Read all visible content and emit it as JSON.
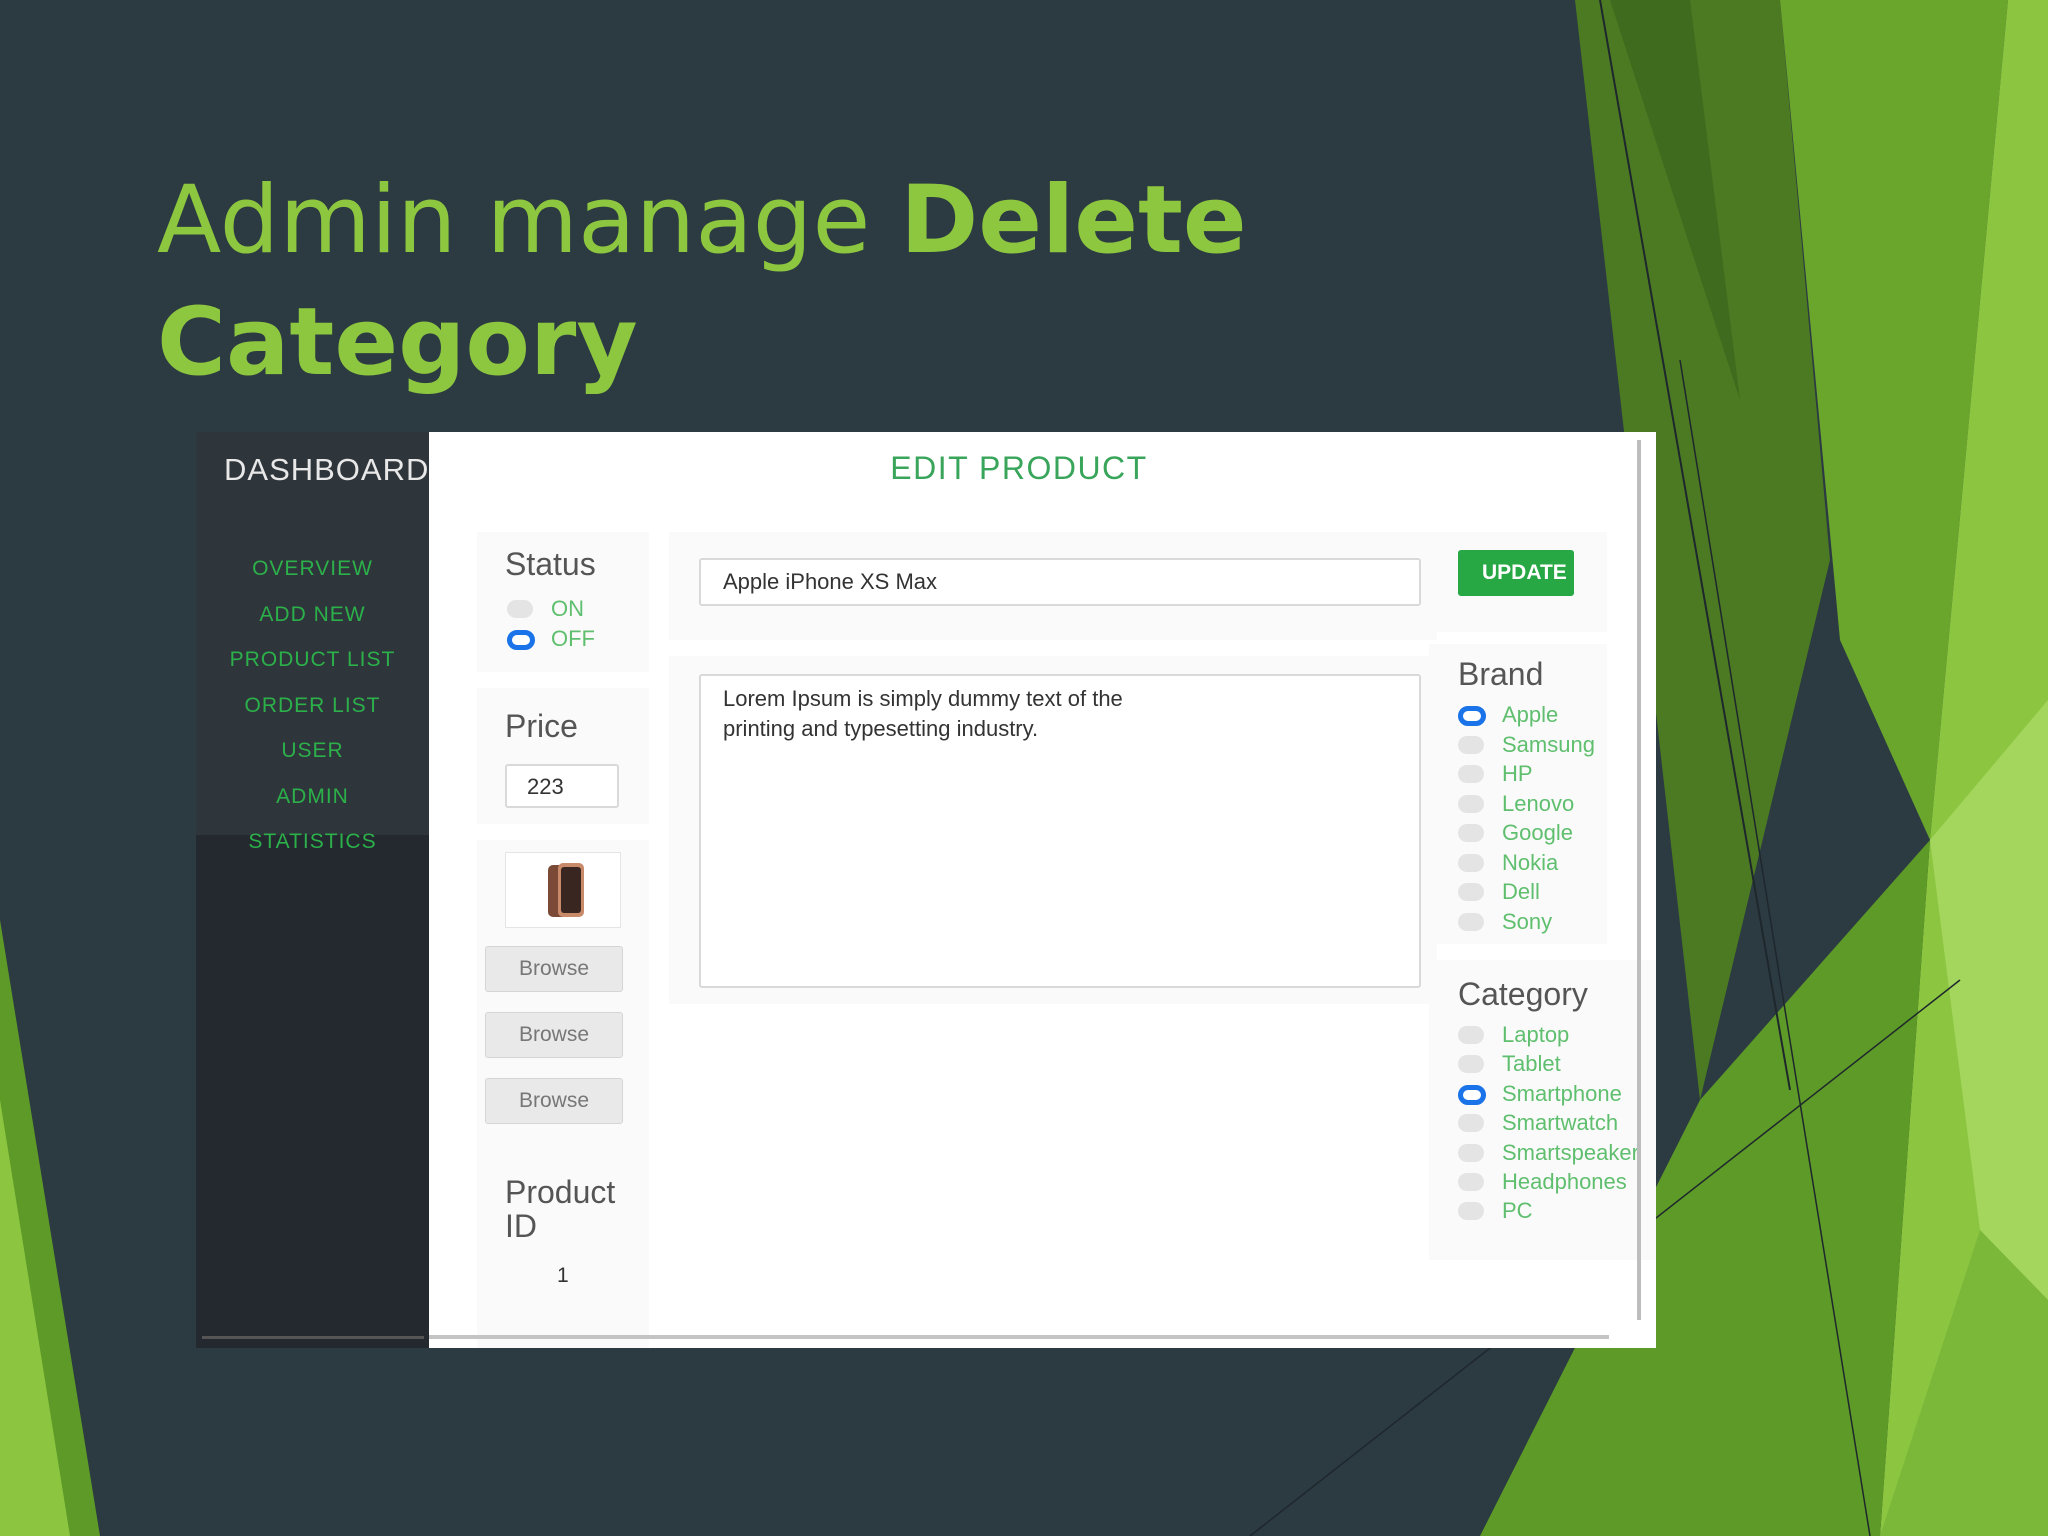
{
  "slide": {
    "title_normal": "Admin manage ",
    "title_bold_1": "Delete",
    "title_bold_2": "Category",
    "colors": {
      "background": "#2c3a42",
      "accent": "#8dc63f"
    }
  },
  "sidebar": {
    "title": "DASHBOARD",
    "items": [
      {
        "label": "OVERVIEW"
      },
      {
        "label": "ADD NEW"
      },
      {
        "label": "PRODUCT LIST"
      },
      {
        "label": "ORDER LIST"
      },
      {
        "label": "USER"
      },
      {
        "label": "ADMIN"
      },
      {
        "label": "STATISTICS"
      }
    ],
    "collapse_icon": "caret-left-icon"
  },
  "edit_product": {
    "title": "EDIT PRODUCT",
    "status": {
      "label": "Status",
      "options": [
        {
          "label": "ON",
          "selected": false
        },
        {
          "label": "OFF",
          "selected": true
        }
      ]
    },
    "price": {
      "label": "Price",
      "value": "223"
    },
    "image": {
      "icon": "phone-image-icon"
    },
    "browse_buttons": [
      "Browse",
      "Browse",
      "Browse"
    ],
    "product_id": {
      "label_line1": "Product",
      "label_line2": "ID",
      "value": "1"
    },
    "name_field": {
      "value": "Apple iPhone XS Max"
    },
    "description": {
      "line1": "Lorem Ipsum is simply dummy text of the",
      "line2": "printing and typesetting industry."
    },
    "update_button": "UPDATE",
    "brand": {
      "label": "Brand",
      "options": [
        {
          "label": "Apple",
          "selected": true
        },
        {
          "label": "Samsung",
          "selected": false
        },
        {
          "label": "HP",
          "selected": false
        },
        {
          "label": "Lenovo",
          "selected": false
        },
        {
          "label": "Google",
          "selected": false
        },
        {
          "label": "Nokia",
          "selected": false
        },
        {
          "label": "Dell",
          "selected": false
        },
        {
          "label": "Sony",
          "selected": false
        }
      ]
    },
    "category": {
      "label": "Category",
      "options": [
        {
          "label": "Laptop",
          "selected": false
        },
        {
          "label": "Tablet",
          "selected": false
        },
        {
          "label": "Smartphone",
          "selected": true
        },
        {
          "label": "Smartwatch",
          "selected": false
        },
        {
          "label": "Smartspeaker",
          "selected": false
        },
        {
          "label": "Headphones",
          "selected": false
        },
        {
          "label": "PC",
          "selected": false
        }
      ]
    }
  }
}
